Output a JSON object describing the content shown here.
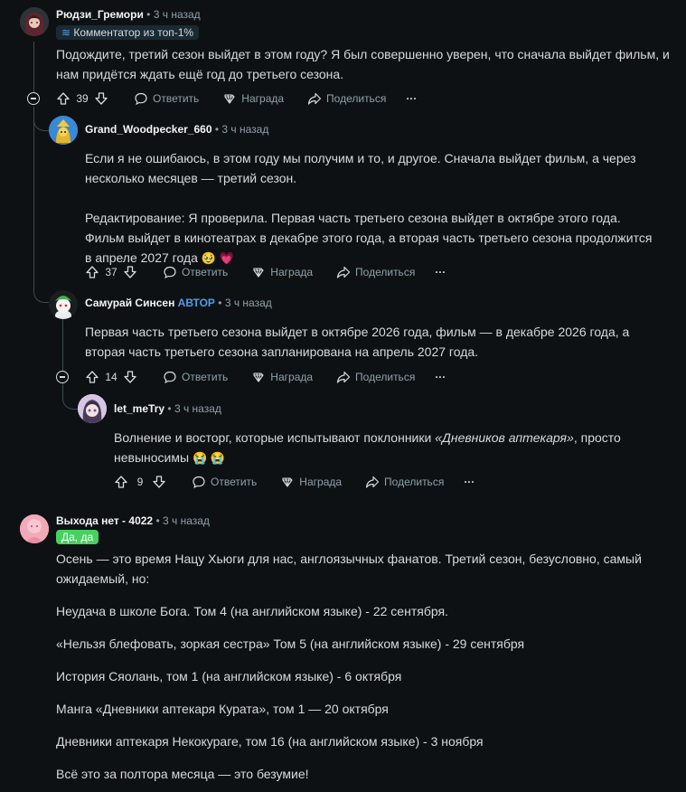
{
  "comments": [
    {
      "author": "Рюдзи_Гремори",
      "time": "3 ч назад",
      "flair": "Комментатор из топ-1%",
      "paragraphs": [
        "Подождите, третий сезон выйдет в этом году? Я был совершенно уверен, что сначала выйдет фильм, и нам придётся ждать ещё год до третьего сезона."
      ],
      "votes": "39",
      "reply": "Ответить",
      "award": "Награда",
      "share": "Поделиться",
      "more": "···"
    },
    {
      "author": "Grand_Woodpecker_660",
      "time": "3 ч назад",
      "paragraphs": [
        "Если я не ошибаюсь, в этом году мы получим и то, и другое. Сначала выйдет фильм, а через несколько месяцев — третий сезон.",
        "Редактирование: Я проверила. Первая часть третьего сезона выйдет в октябре этого года. Фильм выйдет в кинотеатрах в декабре этого года, а вторая часть третьего сезона продолжится в апреле 2027 года"
      ],
      "emoji": "🥹 💗",
      "votes": "37",
      "reply": "Ответить",
      "award": "Награда",
      "share": "Поделиться",
      "more": "···"
    },
    {
      "author": "Самурай Синсен",
      "op_badge": "АВТОР",
      "time": "3 ч назад",
      "paragraphs": [
        "Первая часть третьего сезона выйдет в октябре 2026 года, фильм — в декабре 2026 года, а вторая часть третьего сезона запланирована на апрель 2027 года."
      ],
      "votes": "14",
      "reply": "Ответить",
      "award": "Награда",
      "share": "Поделиться",
      "more": "···"
    },
    {
      "author": "let_meTry",
      "time": "3 ч назад",
      "text_before": "Волнение и восторг, которые испытывают поклонники ",
      "text_italic": "«Дневников аптекаря»",
      "text_after": ", просто невыносимы",
      "emoji": "😭 😭",
      "votes": "9",
      "reply": "Ответить",
      "award": "Награда",
      "share": "Поделиться",
      "more": "···"
    },
    {
      "author": "Выхода нет - 4022",
      "time": "3 ч назад",
      "flair": "Да, да",
      "paragraphs": [
        "Осень — это время Нацу Хьюги для нас, англоязычных фанатов. Третий сезон, безусловно, самый ожидаемый, но:",
        "Неудача в школе Бога. Том 4 (на английском языке) - 22 сентября.",
        "«Нельзя блефовать, зоркая сестра» Том 5 (на английском языке) - 29 сентября",
        "История Сяолань, том 1 (на английском языке) - 6 октября",
        "Манга «Дневники аптекаря Курата», том 1 — 20 октября",
        "Дневники аптекаря Некокураге, том 16 (на английском языке) - 3 ноября",
        "Всё это за полтора месяца — это безумие!"
      ]
    }
  ],
  "colors": {
    "background": "#0e1113",
    "text": "#d7dadc",
    "meta": "#8ba2ad",
    "op_badge": "#4f9ded",
    "flair_bg_1": "#1a2a33",
    "flair_bg_2": "#46d160"
  }
}
